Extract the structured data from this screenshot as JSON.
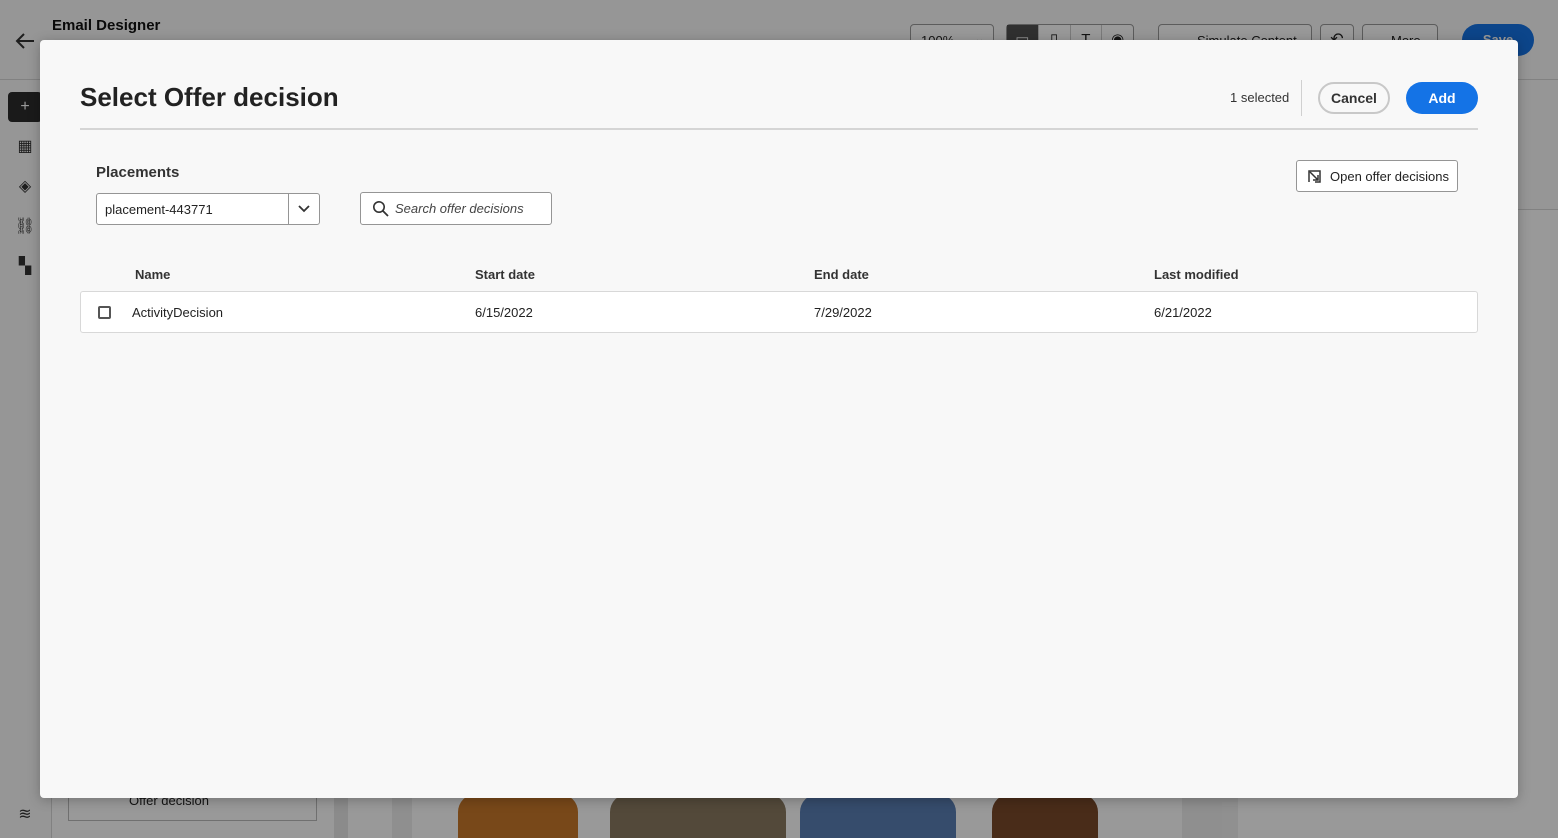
{
  "app": {
    "title": "Email Designer",
    "zoom": "100%",
    "simulate_label": "Simulate Content",
    "more_label": "More",
    "save_label": "Save",
    "component_label": "Offer decision"
  },
  "dialog": {
    "title": "Select Offer decision",
    "selected_count": "1 selected",
    "cancel_label": "Cancel",
    "add_label": "Add",
    "placements_label": "Placements",
    "placement_value": "placement-443771",
    "search_placeholder": "Search offer decisions",
    "open_label": "Open offer decisions",
    "columns": [
      "Name",
      "Start date",
      "End date",
      "Last modified"
    ],
    "rows": [
      {
        "name": "ActivityDecision",
        "start": "6/15/2022",
        "end": "7/29/2022",
        "modified": "6/21/2022",
        "checked": false
      }
    ]
  },
  "colors": {
    "accent": "#1473e6",
    "overlay": "rgba(0,0,0,0.4)",
    "dialog_bg": "#f8f8f8"
  },
  "icons": [
    "back-arrow-icon",
    "chevron-down-icon",
    "plus-icon",
    "image-icon",
    "layers-icon",
    "link-icon",
    "grid-icon",
    "settings-icon",
    "search-icon",
    "open-external-icon",
    "checkbox-icon"
  ]
}
